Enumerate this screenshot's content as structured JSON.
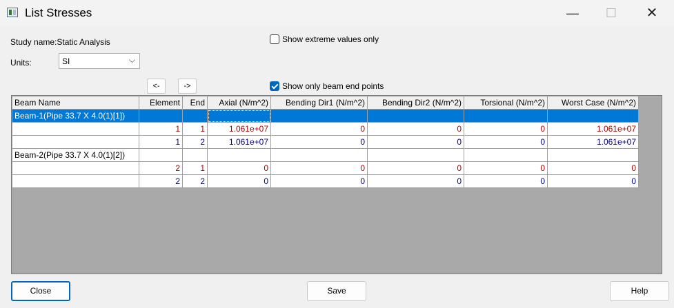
{
  "window": {
    "title": "List Stresses",
    "minimize_glyph": "—",
    "maximize_glyph": "☐",
    "close_glyph": "✕"
  },
  "study": {
    "label": "Study name:Static Analysis"
  },
  "units": {
    "label": "Units:",
    "value": "SI"
  },
  "options": {
    "extreme_only": {
      "label": "Show extreme values only",
      "checked": false
    },
    "beam_end_points": {
      "label": "Show only beam end points",
      "checked": true
    }
  },
  "nav": {
    "prev": "<-",
    "next": "->"
  },
  "table": {
    "columns": [
      "Beam Name",
      "Element",
      "End",
      "Axial (N/m^2)",
      "Bending Dir1 (N/m^2)",
      "Bending Dir2 (N/m^2)",
      "Torsional (N/m^2)",
      "Worst Case (N/m^2)"
    ],
    "rows": [
      {
        "name": "Beam-1(Pipe 33.7 X 4.0(1)[1])",
        "element": "",
        "end": "",
        "axial": "",
        "bending1": "",
        "bending2": "",
        "torsional": "",
        "worst": ""
      },
      {
        "name": "",
        "element": "1",
        "end": "1",
        "axial": "1.061e+07",
        "bending1": "0",
        "bending2": "0",
        "torsional": "0",
        "worst": "1.061e+07"
      },
      {
        "name": "",
        "element": "1",
        "end": "2",
        "axial": "1.061e+07",
        "bending1": "0",
        "bending2": "0",
        "torsional": "0",
        "worst": "1.061e+07"
      },
      {
        "name": "Beam-2(Pipe 33.7 X 4.0(1)[2])",
        "element": "",
        "end": "",
        "axial": "",
        "bending1": "",
        "bending2": "",
        "torsional": "",
        "worst": ""
      },
      {
        "name": "",
        "element": "2",
        "end": "1",
        "axial": "0",
        "bending1": "0",
        "bending2": "0",
        "torsional": "0",
        "worst": "0"
      },
      {
        "name": "",
        "element": "2",
        "end": "2",
        "axial": "0",
        "bending1": "0",
        "bending2": "0",
        "torsional": "0",
        "worst": "0"
      }
    ]
  },
  "buttons": {
    "close": "Close",
    "save": "Save",
    "help": "Help"
  },
  "colors": {
    "selection": "#0078d7",
    "end1_values": "#b00000",
    "end2_values": "#00008b",
    "grid_empty_area": "#a9a9a9",
    "default_button_border": "#0067c0"
  }
}
